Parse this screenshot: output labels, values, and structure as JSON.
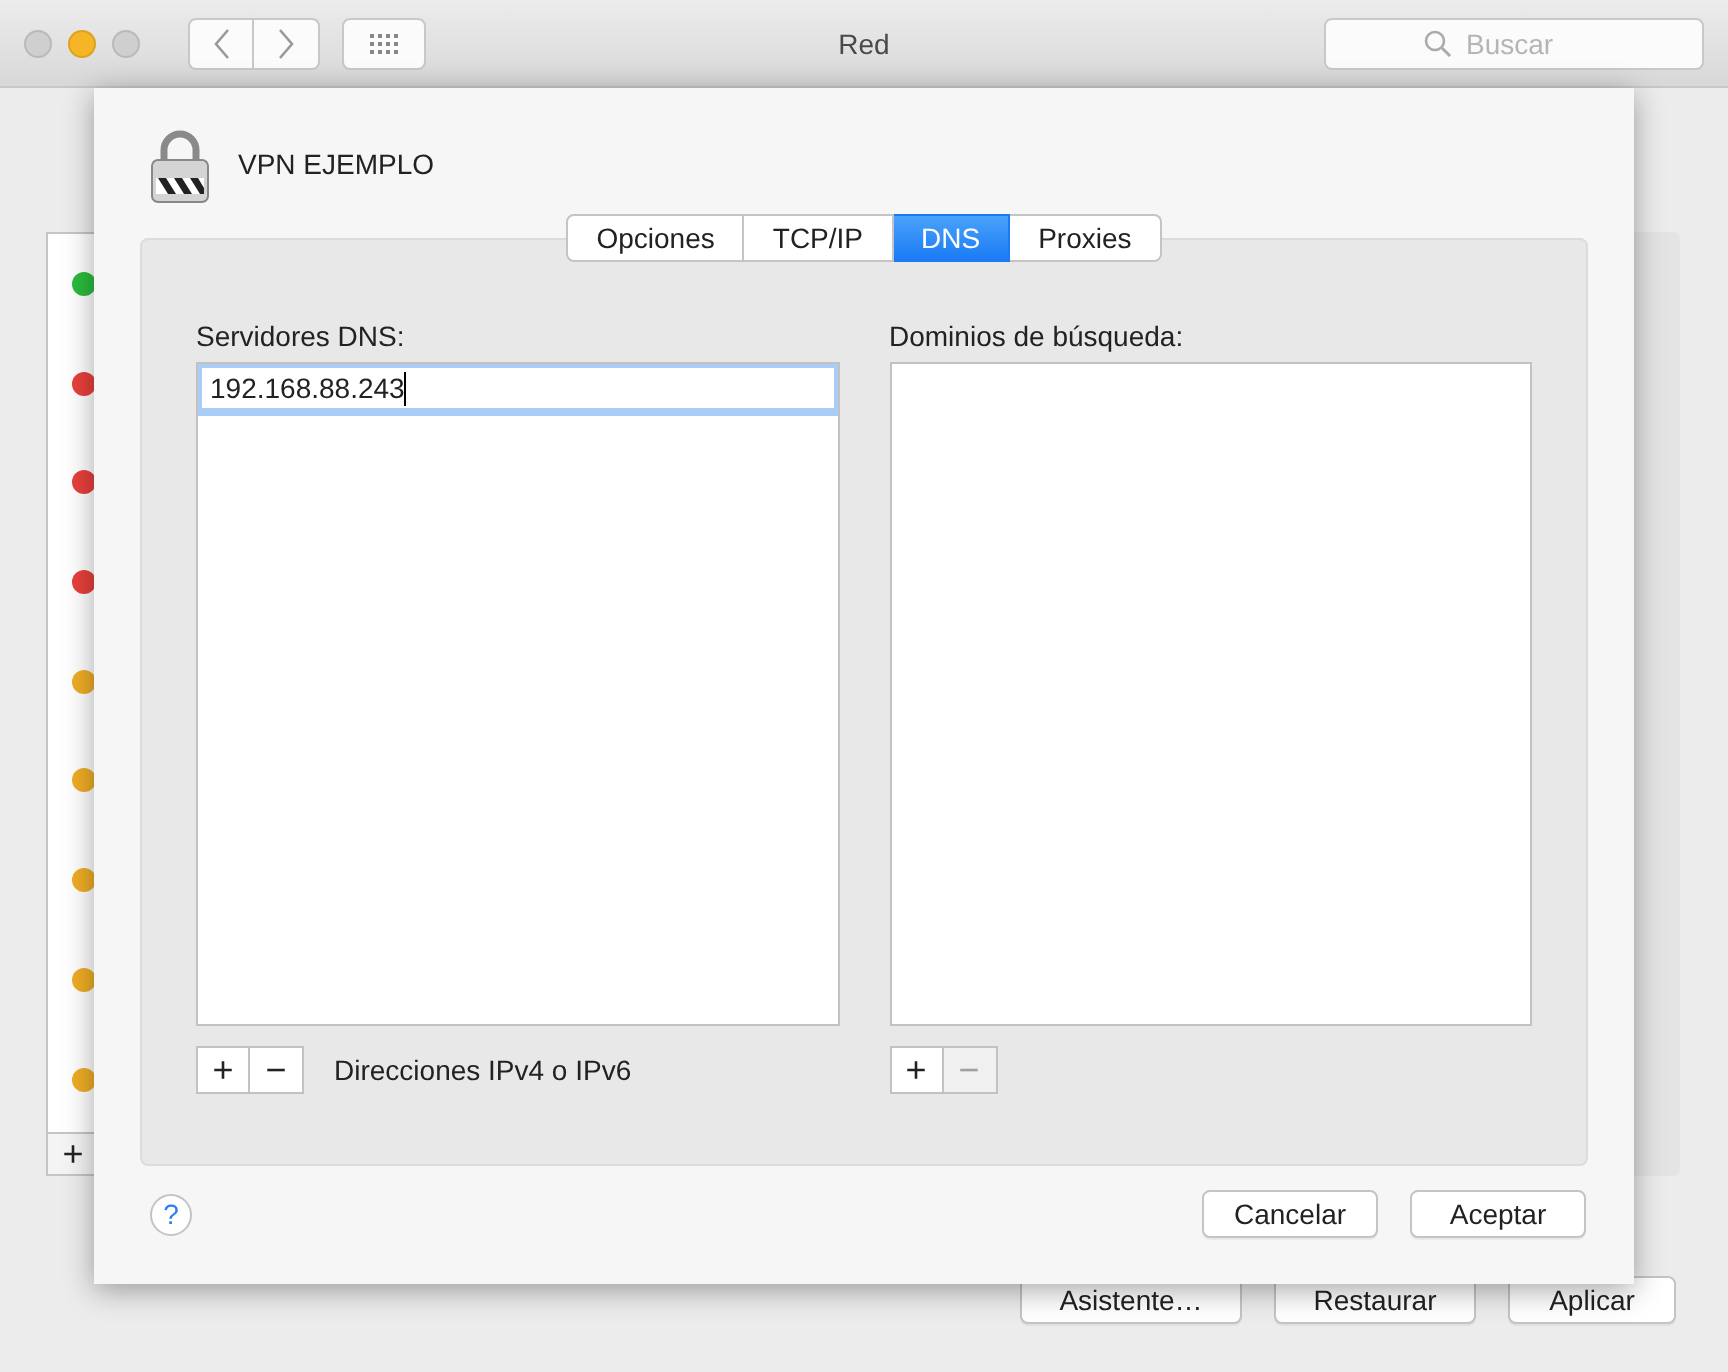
{
  "window": {
    "title": "Red",
    "search": {
      "placeholder": "Buscar"
    }
  },
  "services": [
    {
      "color": "#2bbb3c"
    },
    {
      "color": "#e8403c"
    },
    {
      "color": "#e8403c"
    },
    {
      "color": "#e8403c"
    },
    {
      "color": "#efad26"
    },
    {
      "color": "#efad26"
    },
    {
      "color": "#efad26"
    },
    {
      "color": "#efad26"
    },
    {
      "color": "#efad26"
    }
  ],
  "services_add": "+",
  "sheet": {
    "title": "VPN EJEMPLO",
    "tabs": [
      {
        "label": "Opciones",
        "selected": false
      },
      {
        "label": "TCP/IP",
        "selected": false
      },
      {
        "label": "DNS",
        "selected": true
      },
      {
        "label": "Proxies",
        "selected": false
      }
    ],
    "panes": [
      {
        "label": "Servidores DNS:",
        "entries": [
          {
            "value": "192.168.88.243",
            "editing": true
          }
        ],
        "add": "+",
        "remove": "−",
        "remove_disabled": false,
        "hint": "Direcciones IPv4 o IPv6"
      },
      {
        "label": "Dominios de búsqueda:",
        "add": "+",
        "remove": "−",
        "remove_disabled": true
      }
    ],
    "help": "?",
    "buttons": [
      "Cancelar",
      "Aceptar"
    ]
  },
  "footer_buttons": [
    "Asistente…",
    "Restaurar",
    "Aplicar"
  ]
}
